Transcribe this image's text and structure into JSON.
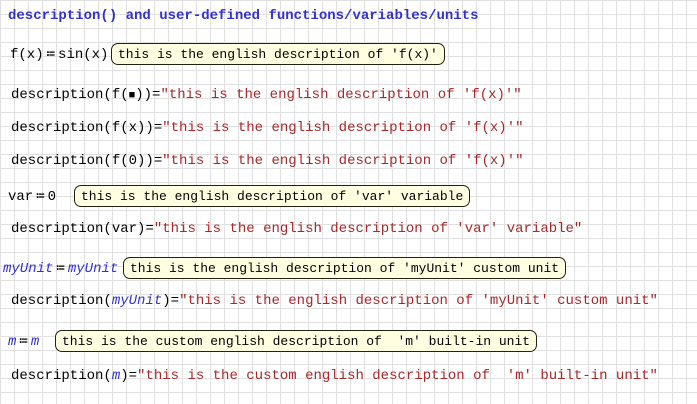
{
  "colors": {
    "title_color": "#3232c8",
    "unit_color": "#3333cc",
    "string_color": "#a62929",
    "text_color": "#000000",
    "box_bg": "#fffee1",
    "box_border": "#222211",
    "grid_color": "#e0e0e0",
    "canvas_bg": "#ffffff"
  },
  "title": {
    "text": "description() and user-defined functions/variables/units"
  },
  "assignments": [
    {
      "name": "f",
      "lhs": "f(x)",
      "op": "≔",
      "rhs": "sin(x)",
      "box": "this is the english description of 'f(x)'"
    },
    {
      "name": "var",
      "lhs": "var",
      "op": "≔",
      "rhs": "0",
      "box": "this is the english description of 'var' variable"
    },
    {
      "name": "myUnit",
      "lhs": "myUnit",
      "op": "≔",
      "rhs": "myUnit",
      "box": "this is the english description of 'myUnit' custom unit"
    },
    {
      "name": "m",
      "lhs": "m",
      "op": "≔",
      "rhs": "m",
      "box": "this is the custom english description of  'm' built-in unit"
    }
  ],
  "descriptions": [
    {
      "pre": "description(f(",
      "arg": "■",
      "post": "))=",
      "result": "\"this is the english description of 'f(x)'\""
    },
    {
      "pre": "description(f(",
      "arg": "x",
      "post": "))=",
      "result": "\"this is the english description of 'f(x)'\""
    },
    {
      "pre": "description(f(",
      "arg": "0",
      "post": "))=",
      "result": "\"this is the english description of 'f(x)'\""
    },
    {
      "pre": "description(",
      "arg": "var",
      "post": ")=",
      "result": "\"this is the english description of 'var' variable\""
    },
    {
      "pre": "description(",
      "arg": "myUnit",
      "post": ")=",
      "result": "\"this is the english description of 'myUnit' custom unit\""
    },
    {
      "pre": "description(",
      "arg": "m",
      "post": ")=",
      "result": "\"this is the custom english description of  'm' built-in unit\""
    }
  ]
}
